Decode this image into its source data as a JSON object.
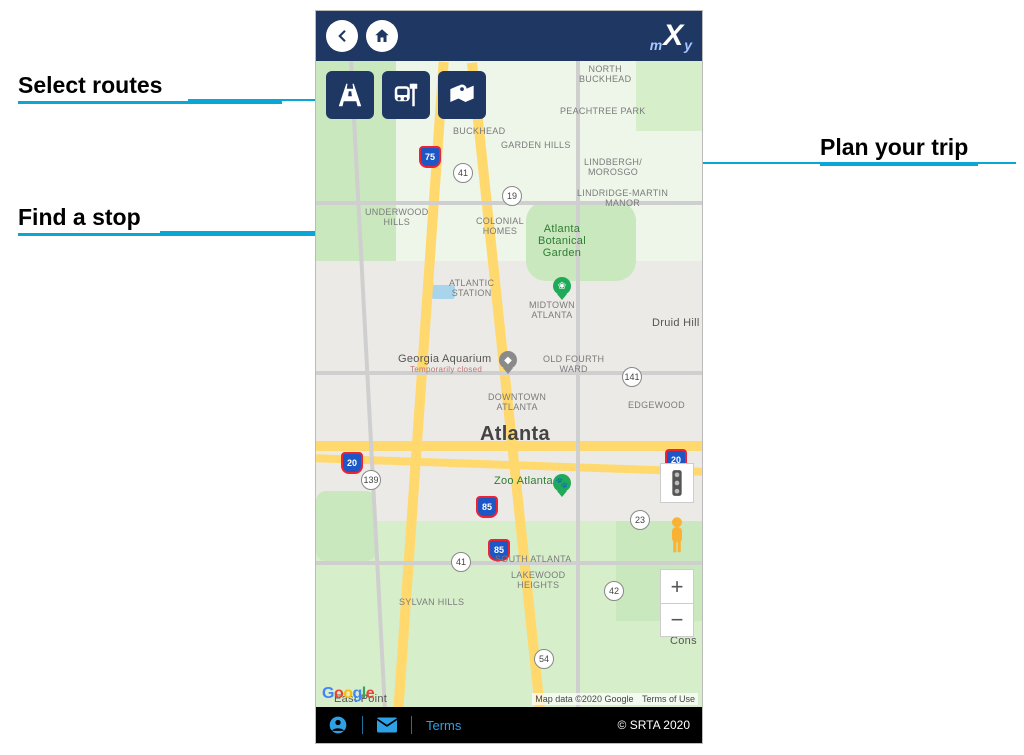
{
  "annotations": {
    "select_routes": "Select routes",
    "find_a_stop": "Find a stop",
    "plan_your_trip": "Plan your trip"
  },
  "topbar": {
    "logo_m": "m",
    "logo_x": "X",
    "logo_y": "y"
  },
  "tools": {
    "routes": "select-routes",
    "stop": "find-stop",
    "trip": "plan-trip"
  },
  "map_labels": {
    "north_buckhead": "NORTH\nBUCKHEAD",
    "peachtree_park": "PEACHTREE PARK",
    "buckhead": "BUCKHEAD",
    "garden_hills": "GARDEN HILLS",
    "lindbergh": "LINDBERGH/\nMOROSGO",
    "lindridge": "LINDRIDGE-MARTIN\nMANOR",
    "underwood": "UNDERWOOD\nHILLS",
    "colonial": "COLONIAL\nHOMES",
    "botanical": "Atlanta\nBotanical\nGarden",
    "atlantic": "ATLANTIC\nSTATION",
    "midtown": "MIDTOWN\nATLANTA",
    "druid": "Druid Hill",
    "georgia_aq": "Georgia Aquarium",
    "temp_closed": "Temporarily closed",
    "old_fourth": "OLD FOURTH\nWARD",
    "downtown": "DOWNTOWN\nATLANTA",
    "edgewood": "EDGEWOOD",
    "atlanta_big": "Atlanta",
    "zoo": "Zoo Atlanta",
    "south_atl": "SOUTH ATLANTA",
    "lakewood": "LAKEWOOD\nHEIGHTS",
    "sylvan": "SYLVAN HILLS",
    "cons": "Cons",
    "east_point": "East Point"
  },
  "highways": {
    "i75": "75",
    "i85a": "85",
    "i85b": "85",
    "i20a": "20",
    "i20b": "20"
  },
  "routes": {
    "r41a": "41",
    "r19": "19",
    "r141": "141",
    "r139": "139",
    "r23": "23",
    "r41b": "41",
    "r42": "42",
    "r54": "54"
  },
  "attribution": {
    "mapdata": "Map data ©2020 Google",
    "terms": "Terms of Use"
  },
  "bottombar": {
    "terms": "Terms",
    "copyright": "© SRTA 2020"
  },
  "colors": {
    "navy": "#1e3763",
    "cyan": "#0aa7d6"
  }
}
